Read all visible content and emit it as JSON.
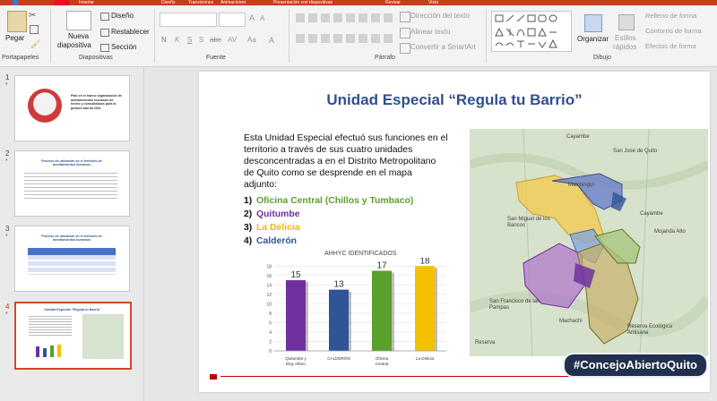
{
  "titlebar": {
    "tabs": [
      "Inicio",
      "Insertar",
      "Diseño",
      "Transiciones",
      "Animaciones",
      "Presentación con diapositivas",
      "Revisar",
      "Vista"
    ]
  },
  "ribbon": {
    "clipboard": {
      "paste": "Pegar",
      "group": "Portapapeles"
    },
    "slides": {
      "new_slide": "Nueva",
      "new_slide2": "diapositiva",
      "layout": "Diseño",
      "reset": "Restablecer",
      "section": "Sección",
      "group": "Diapositivas"
    },
    "font": {
      "bold": "N",
      "italic": "K",
      "underline": "S",
      "strike": "abc",
      "shadow": "S",
      "spacing": "AV",
      "case": "Aa",
      "group": "Fuente"
    },
    "paragraph": {
      "text_direction": "Dirección del texto",
      "align_text": "Alinear texto",
      "smartart": "Convertir a SmartArt",
      "group": "Párrafo"
    },
    "drawing": {
      "arrange": "Organizar",
      "quick_styles": "Estilos",
      "quick_styles2": "rápidos",
      "fill": "Relleno de forma",
      "outline": "Contorno de forma",
      "effects": "Efectos de forma",
      "group": "Dibujo"
    }
  },
  "thumbnails": [
    {
      "num": "1",
      "star": "*",
      "text": "Plan en el marco organización de asentamientos humanos de hecho y consolidados para la gestión barrial 2021"
    },
    {
      "num": "2",
      "star": "*",
      "text": "Proceso de ubicación en el territorio de asentamientos humanos"
    },
    {
      "num": "3",
      "star": "*",
      "text": "Proceso de ubicación en el territorio de asentamientos humanos"
    },
    {
      "num": "4",
      "star": "*",
      "text": "Unidad Especial \"Regula tu Barrio\""
    }
  ],
  "slide": {
    "title": "Unidad Especial “Regula tu Barrio”",
    "body": [
      "Esta Unidad Especial efectuó sus funciones en el",
      "territorio a través de sus cuatro unidades",
      "desconcentradas a en el Distrito Metropolitano",
      "de Quito como se desprende en el mapa",
      "adjunto:"
    ],
    "list": [
      {
        "num": "1)",
        "text": "Oficina Central (Chillos y Tumbaco)",
        "color": "#5aa02c"
      },
      {
        "num": "2)",
        "text": "Quitumbe",
        "color": "#7030a0"
      },
      {
        "num": "3)",
        "text": "La Delicia",
        "color": "#f2b800"
      },
      {
        "num": "4)",
        "text": "Calderón",
        "color": "#2f5597"
      }
    ],
    "map_labels": {
      "cayambe": "Cayambe",
      "san_jose": "San José de Quito",
      "malchingui": "Malchinguí",
      "san_miguel": "San Miguel de los Bancos",
      "cayambe2": "Cayambe",
      "mojanda": "Mojanda Alto",
      "san_francisco": "San Francisco de las Pampas",
      "machachi": "Machachi",
      "reserva": "Reserva",
      "reserva_eco": "Reserva Ecológica Antisana"
    }
  },
  "chart_data": {
    "type": "bar",
    "title": "AHHYC IDENTIFICADOS",
    "categories": [
      "Quitumbe y Eloy Alfaro",
      "CALDERÓN",
      "Oficina Central",
      "La Delicia"
    ],
    "values": [
      15,
      13,
      17,
      18
    ],
    "colors": [
      "#7030a0",
      "#2f5597",
      "#5aa02c",
      "#f2c200"
    ],
    "yticks": [
      0,
      2,
      4,
      6,
      8,
      10,
      12,
      14,
      16,
      18
    ],
    "ylim": [
      0,
      19
    ],
    "grid": true
  },
  "overlay": {
    "hashtag": "#ConcejoAbiertoQuito"
  }
}
